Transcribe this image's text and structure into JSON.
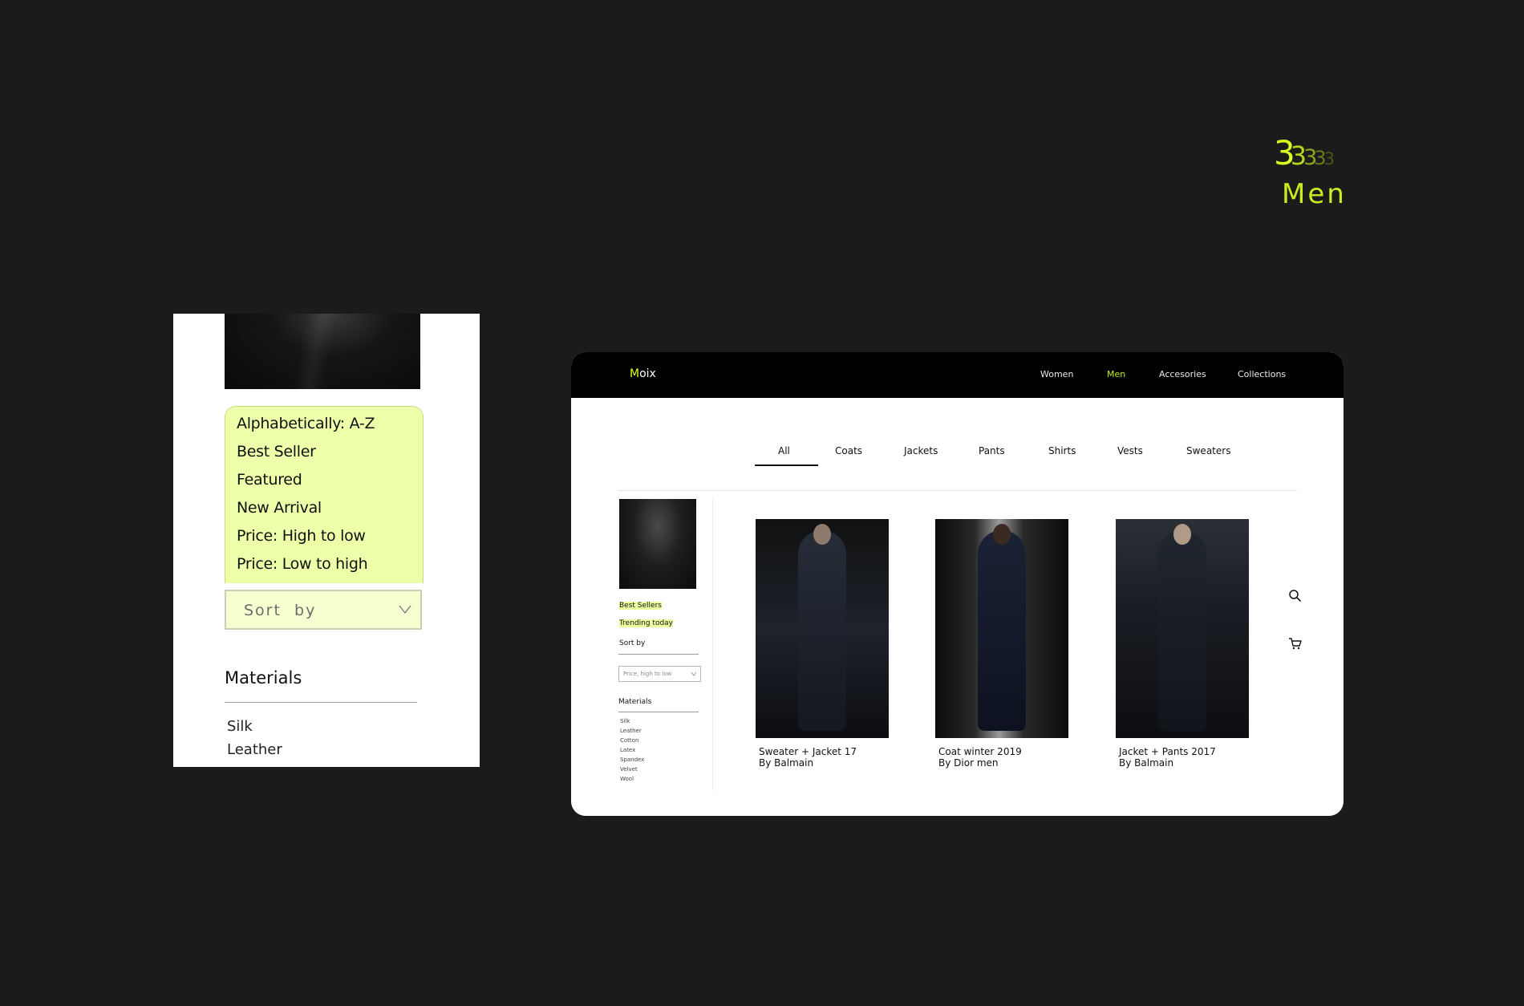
{
  "page_number": {
    "digits": [
      "3",
      "3",
      "3",
      "3",
      "3"
    ]
  },
  "section_title": "Men",
  "mobile": {
    "sort_options": [
      "Alphabetically: A-Z",
      "Best Seller",
      "Featured",
      "New Arrival",
      "Price: High to low",
      "Price: Low to high"
    ],
    "sort_label": "Sort  by",
    "materials_title": "Materials",
    "materials": [
      "Silk",
      "Leather"
    ]
  },
  "desktop": {
    "logo": {
      "first": "M",
      "rest": "oix"
    },
    "nav": [
      "Women",
      "Men",
      "Accesories",
      "Collections"
    ],
    "nav_active": "Men",
    "tabs": [
      "All",
      "Coats",
      "Jackets",
      "Pants",
      "Shirts",
      "Vests",
      "Sweaters"
    ],
    "tab_active": "All",
    "sidebar": {
      "links": [
        "Best Sellers",
        "Trending today"
      ],
      "sort_title": "Sort by",
      "sort_value": "Price, high to low",
      "materials_title": "Materials",
      "materials": [
        "Silk",
        "Leather",
        "Cotton",
        "Latex",
        "Spandex",
        "Velvet",
        "Wool"
      ]
    },
    "products": [
      {
        "name": "Sweater + Jacket 17",
        "brand": "By Balmain"
      },
      {
        "name": "Coat winter 2019",
        "brand": "By Dior men"
      },
      {
        "name": "Jacket + Pants 2017",
        "brand": "By Balmain"
      }
    ]
  },
  "colors": {
    "accent": "#d8ff20",
    "highlight": "#eeffa9",
    "background": "#1b1b1b"
  },
  "icons": [
    "search-icon",
    "cart-icon",
    "chevron-down-icon"
  ]
}
